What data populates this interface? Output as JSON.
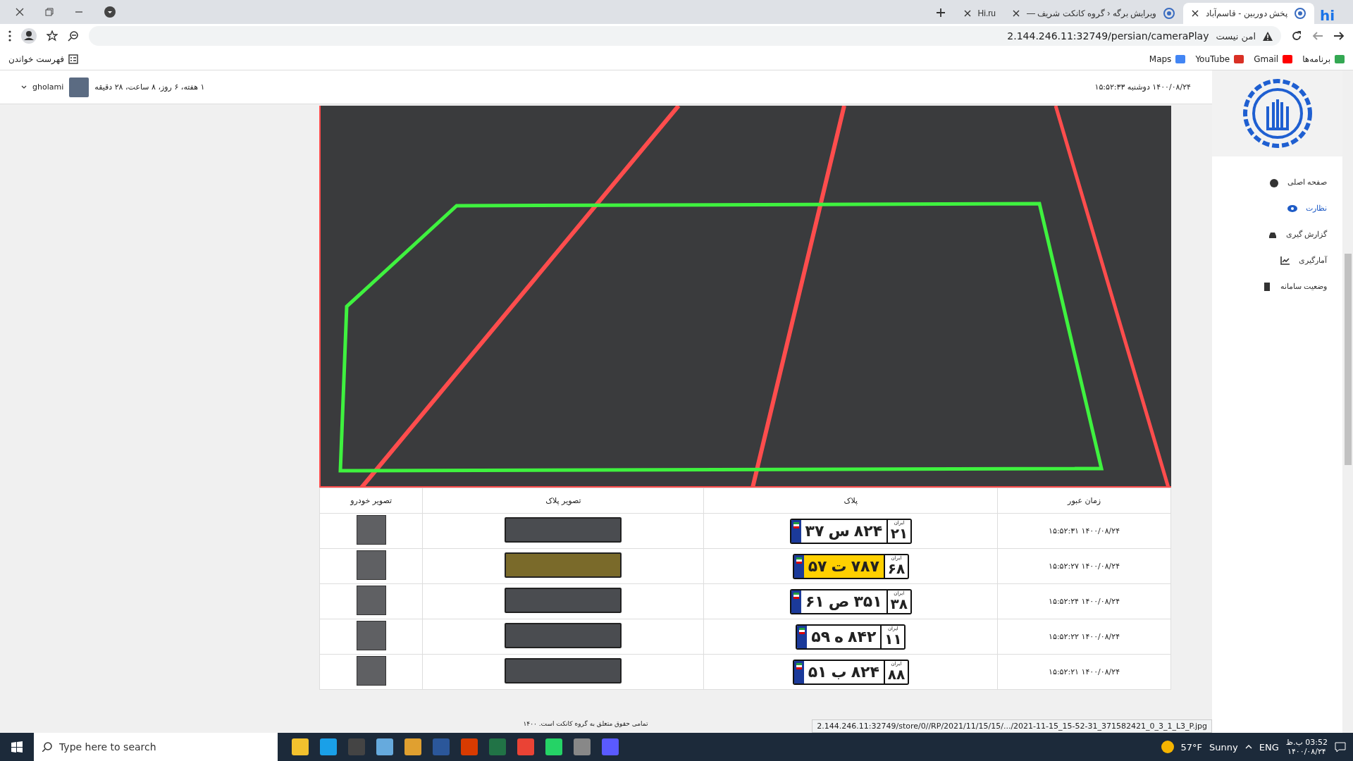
{
  "browser": {
    "app_logo": "hi",
    "tabs": [
      {
        "title": "پخش دوربین - قاسم‌آباد",
        "selected": true
      },
      {
        "title": "ویرایش برگه ‹ گروه کانکت شریف —",
        "selected": false
      },
      {
        "title": "Hi.ru",
        "selected": false
      }
    ],
    "address": {
      "security": "امن نیست",
      "url": "2.144.246.11:32749/persian/cameraPlay"
    },
    "bookmarks": [
      "برنامه‌ها",
      "Gmail",
      "YouTube",
      "Maps"
    ],
    "reading_list": "فهرست خواندن"
  },
  "header": {
    "datetime": "۱۴۰۰/۰۸/۲۴ دوشنبه ۱۵:۵۲:۳۳",
    "session": "۱ هفته، ۶ روز، ۸ ساعت، ۲۸ دقیقه",
    "user": "gholami"
  },
  "sidebar": {
    "items": [
      {
        "label": "صفحه اصلی",
        "selected": false
      },
      {
        "label": "نظارت",
        "selected": true
      },
      {
        "label": "گزارش گیری",
        "selected": false
      },
      {
        "label": "آمارگیری",
        "selected": false
      },
      {
        "label": "وضعیت سامانه",
        "selected": false
      }
    ]
  },
  "table": {
    "columns": [
      "زمان عبور",
      "پلاک",
      "تصویر پلاک",
      "تصویر خودرو"
    ],
    "rows": [
      {
        "time": "۱۴۰۰/۰۸/۲۴ ۱۵:۵۲:۳۱",
        "plate": {
          "country": "ایران",
          "region": "۲۱",
          "digits": "۸۲۴",
          "letter": "س",
          "serial": "۳۷",
          "yellow": false
        }
      },
      {
        "time": "۱۴۰۰/۰۸/۲۴ ۱۵:۵۲:۲۷",
        "plate": {
          "country": "ایران",
          "region": "۶۸",
          "digits": "۷۸۷",
          "letter": "ت",
          "serial": "۵۷",
          "yellow": true
        }
      },
      {
        "time": "۱۴۰۰/۰۸/۲۴ ۱۵:۵۲:۲۴",
        "plate": {
          "country": "ایران",
          "region": "۳۸",
          "digits": "۳۵۱",
          "letter": "ص",
          "serial": "۶۱",
          "yellow": false
        }
      },
      {
        "time": "۱۴۰۰/۰۸/۲۴ ۱۵:۵۲:۲۲",
        "plate": {
          "country": "ایران",
          "region": "۱۱",
          "digits": "۸۴۲",
          "letter": "ه",
          "serial": "۵۹",
          "yellow": false
        }
      },
      {
        "time": "۱۴۰۰/۰۸/۲۴ ۱۵:۵۲:۲۱",
        "plate": {
          "country": "ایران",
          "region": "۸۸",
          "digits": "۸۲۴",
          "letter": "ب",
          "serial": "۵۱",
          "yellow": false
        }
      }
    ]
  },
  "footer": "تمامی حقوق متعلق به گروه کانکت است. ۱۴۰۰",
  "status_url": "2.144.246.11:32749/store/0//RP/2021/11/15/15/.../2021-11-15_15-52-31_371582421_0_3_1_L3_P.jpg",
  "taskbar": {
    "search_placeholder": "Type here to search",
    "temperature": "57°F",
    "weather": "Sunny",
    "language": "ENG",
    "time": "03:52 ب.ظ",
    "date": "۱۴۰۰/۰۸/۲۴"
  }
}
